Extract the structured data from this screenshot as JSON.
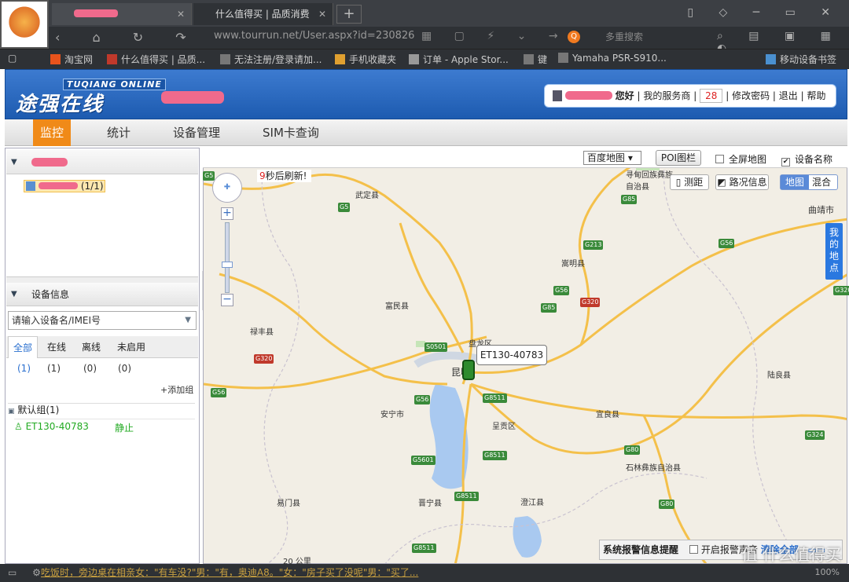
{
  "browser": {
    "tabs": [
      {
        "label": "",
        "close": "✕"
      },
      {
        "label": "什么值得买 | 品质消费",
        "close": "✕"
      }
    ],
    "new_tab": "+",
    "url": "www.tourrun.net/User.aspx?id=230826",
    "search_placeholder": "多重搜索",
    "search_engine_icon": "Q",
    "bookmarks": [
      "淘宝网",
      "什么值得买 | 品质...",
      "无法注册/登录请加...",
      "手机收藏夹",
      "订单 - Apple Stor...",
      "键",
      "Yamaha PSR-S910...",
      "移动设备书签"
    ]
  },
  "app": {
    "logo_en": "TUQIANG ONLINE",
    "logo_cn": "途强在线",
    "user": {
      "greeting": "您好",
      "links": [
        "我的服务商",
        "28",
        "修改密码",
        "退出",
        "帮助"
      ],
      "separator": "|"
    },
    "menu": [
      "监控",
      "统计",
      "设备管理",
      "SIM卡查询"
    ]
  },
  "left": {
    "tree_node_count": "(1/1)",
    "device_panel_title": "设备信息",
    "search_placeholder": "请输入设备名/IMEI号",
    "tabs": [
      "全部",
      "在线",
      "离线",
      "未启用"
    ],
    "counts": [
      "(1)",
      "(1)",
      "(0)",
      "(0)"
    ],
    "add_group": "+添加组",
    "group": "默认组(1)",
    "device": {
      "name": "ET130-40783",
      "state": "静止"
    }
  },
  "map": {
    "map_type_select": "百度地图 ▾",
    "poi_button": "POI图栏",
    "fullscreen_label": "全屏地图",
    "device_name_label": "设备名称",
    "refresh_seconds": "9",
    "refresh_text": "秒后刷新!",
    "measure_button": "测距",
    "traffic_button": "路况信息",
    "type_map": "地图",
    "type_hybrid": "混合",
    "my_location": "我的地点",
    "device_tooltip": "ET130-40783",
    "alarm_title": "系统报警信息提醒",
    "alarm_sound": "开启报警声音",
    "alarm_clear": "清除全部",
    "labels": {
      "wuding": "武定县",
      "fumin": "富民县",
      "lufeng": "禄丰县",
      "anning": "安宁市",
      "panlong": "盘龙区",
      "chenggong": "呈贡区",
      "songming": "嵩明县",
      "yiliang": "宜良县",
      "luliang": "陆良县",
      "qujing": "曲靖市",
      "shilin": "石林彝族自治县",
      "yimen": "易门县",
      "jinning": "晋宁县",
      "chengjiang": "澄江县",
      "kunming": "昆明",
      "xundian": "寻甸回族彝族自治县",
      "scale": "20 公里"
    },
    "roads": [
      "G5",
      "G5",
      "G85",
      "G213",
      "G56",
      "G56",
      "G320",
      "G85",
      "S0501",
      "G56",
      "G8511",
      "G320",
      "G56",
      "G5601",
      "G8511",
      "G80",
      "G8511",
      "G80",
      "G324",
      "G8511",
      "G320"
    ]
  },
  "status": {
    "ticker": "吃饭时，旁边桌在相亲女：\"有车没?\"男：\"有，奥迪A8。\"女：\"房子买了没呢\"男：\"买了...",
    "watermark": "值 什么值得买",
    "zoom": "100%"
  }
}
